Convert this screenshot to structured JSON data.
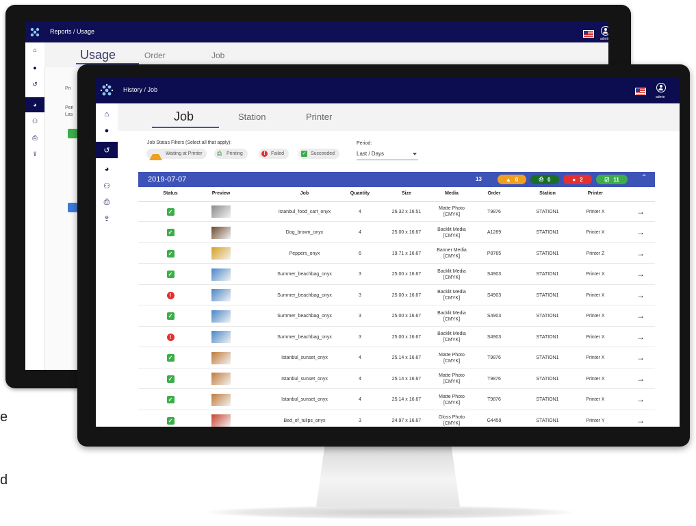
{
  "back": {
    "breadcrumb": "Reports / Usage",
    "tabs": [
      "Usage",
      "Order",
      "Job"
    ],
    "admin": "admin",
    "snippets": [
      "Pri",
      "Peri",
      "Las"
    ]
  },
  "side_text": [
    "e",
    "d"
  ],
  "front": {
    "breadcrumb": "History / Job",
    "admin": "admin",
    "tabs": [
      "Job",
      "Station",
      "Printer"
    ],
    "filters_label": "Job Status Filters (Select all that apply):",
    "filters": [
      {
        "label": "Waiting at Printer",
        "icon": "warning-icon",
        "color": "#f0a020"
      },
      {
        "label": "Printing",
        "icon": "printer-icon",
        "color": "#1a7a2a"
      },
      {
        "label": "Failed",
        "icon": "error-icon",
        "color": "#e53030"
      },
      {
        "label": "Succeeded",
        "icon": "check-icon",
        "color": "#3cae48"
      }
    ],
    "period_label": "Period:",
    "period_value": "Last / Days",
    "group": {
      "date": "2019-07-07",
      "count": "13",
      "pills": [
        {
          "icon": "warning-icon",
          "value": "0",
          "color": "#f0a020"
        },
        {
          "icon": "printer-icon",
          "value": "0",
          "color": "#1a6e27"
        },
        {
          "icon": "error-icon",
          "value": "2",
          "color": "#e53030"
        },
        {
          "icon": "check-icon",
          "value": "11",
          "color": "#3cae48"
        }
      ]
    },
    "columns": [
      "Status",
      "Preview",
      "Job",
      "Quantity",
      "Size",
      "Media",
      "Order",
      "Station",
      "Printer"
    ],
    "rows": [
      {
        "status": "succeeded",
        "job": "Istanbul_food_cart_onyx",
        "qty": "4",
        "size": "26.32 x 16.51",
        "media1": "Matte Photo",
        "media2": "[CMYK]",
        "order": "T9876",
        "station": "STATION1",
        "printer": "Printer X",
        "thumb": "#8a8a8a"
      },
      {
        "status": "succeeded",
        "job": "Dog_brown_onyx",
        "qty": "4",
        "size": "25.00 x 16.67",
        "media1": "Backlit Media",
        "media2": "[CMYK]",
        "order": "A1289",
        "station": "STATION1",
        "printer": "Printer X",
        "thumb": "#6b4a2a"
      },
      {
        "status": "succeeded",
        "job": "Peppers_onyx",
        "qty": "6",
        "size": "19.71 x 16.67",
        "media1": "Banner Media",
        "media2": "[CMYK]",
        "order": "P8765",
        "station": "STATION1",
        "printer": "Printer Z",
        "thumb": "#d8a020"
      },
      {
        "status": "succeeded",
        "job": "Summer_beachbag_onyx",
        "qty": "3",
        "size": "25.00 x 16.67",
        "media1": "Backlit Media",
        "media2": "[CMYK]",
        "order": "S4903",
        "station": "STATION1",
        "printer": "Printer X",
        "thumb": "#4a86c8"
      },
      {
        "status": "failed",
        "job": "Summer_beachbag_onyx",
        "qty": "3",
        "size": "25.00 x 16.67",
        "media1": "Backlit Media",
        "media2": "[CMYK]",
        "order": "S4903",
        "station": "STATION1",
        "printer": "Printer X",
        "thumb": "#4a86c8"
      },
      {
        "status": "succeeded",
        "job": "Summer_beachbag_onyx",
        "qty": "3",
        "size": "25.00 x 16.67",
        "media1": "Backlit Media",
        "media2": "[CMYK]",
        "order": "S4903",
        "station": "STATION1",
        "printer": "Printer X",
        "thumb": "#4a86c8"
      },
      {
        "status": "failed",
        "job": "Summer_beachbag_onyx",
        "qty": "3",
        "size": "25.00 x 16.67",
        "media1": "Backlit Media",
        "media2": "[CMYK]",
        "order": "S4903",
        "station": "STATION1",
        "printer": "Printer X",
        "thumb": "#4a86c8"
      },
      {
        "status": "succeeded",
        "job": "Istanbul_sunset_onyx",
        "qty": "4",
        "size": "25.14 x 16.67",
        "media1": "Matte Photo",
        "media2": "[CMYK]",
        "order": "T9876",
        "station": "STATION1",
        "printer": "Printer X",
        "thumb": "#c07a3a"
      },
      {
        "status": "succeeded",
        "job": "Istanbul_sunset_onyx",
        "qty": "4",
        "size": "25.14 x 16.67",
        "media1": "Matte Photo",
        "media2": "[CMYK]",
        "order": "T9876",
        "station": "STATION1",
        "printer": "Printer X",
        "thumb": "#c07a3a"
      },
      {
        "status": "succeeded",
        "job": "Istanbul_sunset_onyx",
        "qty": "4",
        "size": "25.14 x 16.67",
        "media1": "Matte Photo",
        "media2": "[CMYK]",
        "order": "T9876",
        "station": "STATION1",
        "printer": "Printer X",
        "thumb": "#c07a3a"
      },
      {
        "status": "succeeded",
        "job": "Bed_of_tulips_onyx",
        "qty": "3",
        "size": "24.97 x 16.67",
        "media1": "Gloss Photo",
        "media2": "[CMYK]",
        "order": "G4459",
        "station": "STATION1",
        "printer": "Printer Y",
        "thumb": "#c8402a"
      }
    ]
  },
  "colors": {
    "navy": "#0c0c50",
    "accent": "#3d53b8",
    "succeeded": "#3cae48",
    "failed": "#e53030",
    "warning": "#f0a020"
  }
}
